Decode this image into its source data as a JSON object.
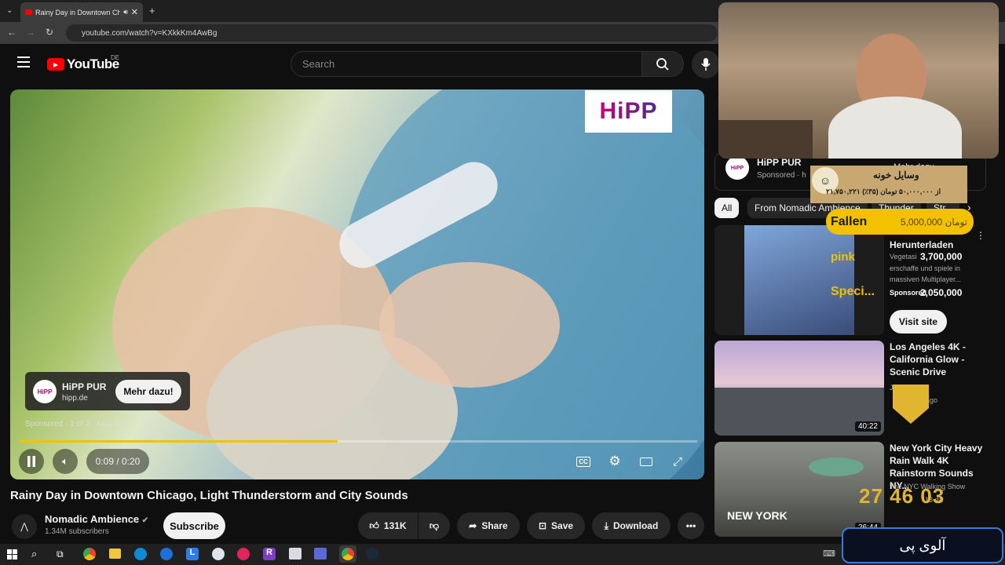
{
  "browser": {
    "tab_title": "Rainy Day in Downtown Ch",
    "new_tab": "+",
    "url": "youtube.com/watch?v=KXkkKm4AwBg"
  },
  "youtube": {
    "logo_text": "YouTube",
    "region": "DE",
    "search_placeholder": "Search"
  },
  "ad": {
    "brand_logo": "HiPP",
    "card_title": "HiPP PUR",
    "card_domain": "hipp.de",
    "cta": "Mehr dazu!",
    "sponsored_line": "Sponsored · 1 of 2 · hipp.de"
  },
  "player": {
    "time": "0:09 / 0:20",
    "progress_fraction": 0.47
  },
  "video": {
    "title": "Rainy Day in Downtown Chicago, Light Thunderstorm and City Sounds",
    "channel": "Nomadic Ambience",
    "subscribers": "1.34M subscribers",
    "subscribe_label": "Subscribe",
    "likes": "131K",
    "share_label": "Share",
    "save_label": "Save",
    "download_label": "Download"
  },
  "sidebar": {
    "ad": {
      "title": "HiPP PUR",
      "sponsored": "Sponsored · h",
      "more": "Mehr dazu"
    },
    "chips": [
      "All",
      "From Nomadic Ambience",
      "Thunder",
      "Str"
    ],
    "promo": {
      "title": "Herunterladen",
      "overlay_a": "pink",
      "overlay_b": "Speci...",
      "meta_line1": "Vegetasi",
      "meta_line2": "erschaffe und spiele in",
      "meta_line3": "massiven Multiplayer...",
      "sponsored": "Sponsored",
      "visit": "Visit site",
      "amount_a": "3,700,000",
      "amount_b": "2,050,000"
    },
    "videos": [
      {
        "title": "Los Angeles 4K - California Glow - Scenic Drive",
        "channel": "J Utah",
        "age": "ly ago",
        "duration": "40:22"
      },
      {
        "title": "New York City Heavy Rain Walk 4K Rainstorm Sounds NY...",
        "channel": "The NYC Walking Show",
        "age": "13 da",
        "duration": "26:44",
        "thumb_text": "NEW YORK"
      }
    ]
  },
  "overlays": {
    "donation_title": "وسایل خونه",
    "donation_line": "۲۱,۷۵۰,۲۲۱ از ۵۰,۰۰۰,۰۰۰ تومان (۳۵٪)",
    "fallen_name": "Fallen",
    "fallen_amount": "5,000,000 تومان",
    "alloy": "آلوی پی",
    "timer": "27 46 03"
  },
  "colors": {
    "youtube_red": "#ff0000",
    "progress": "#f2c100",
    "background": "#0f0f0f"
  }
}
